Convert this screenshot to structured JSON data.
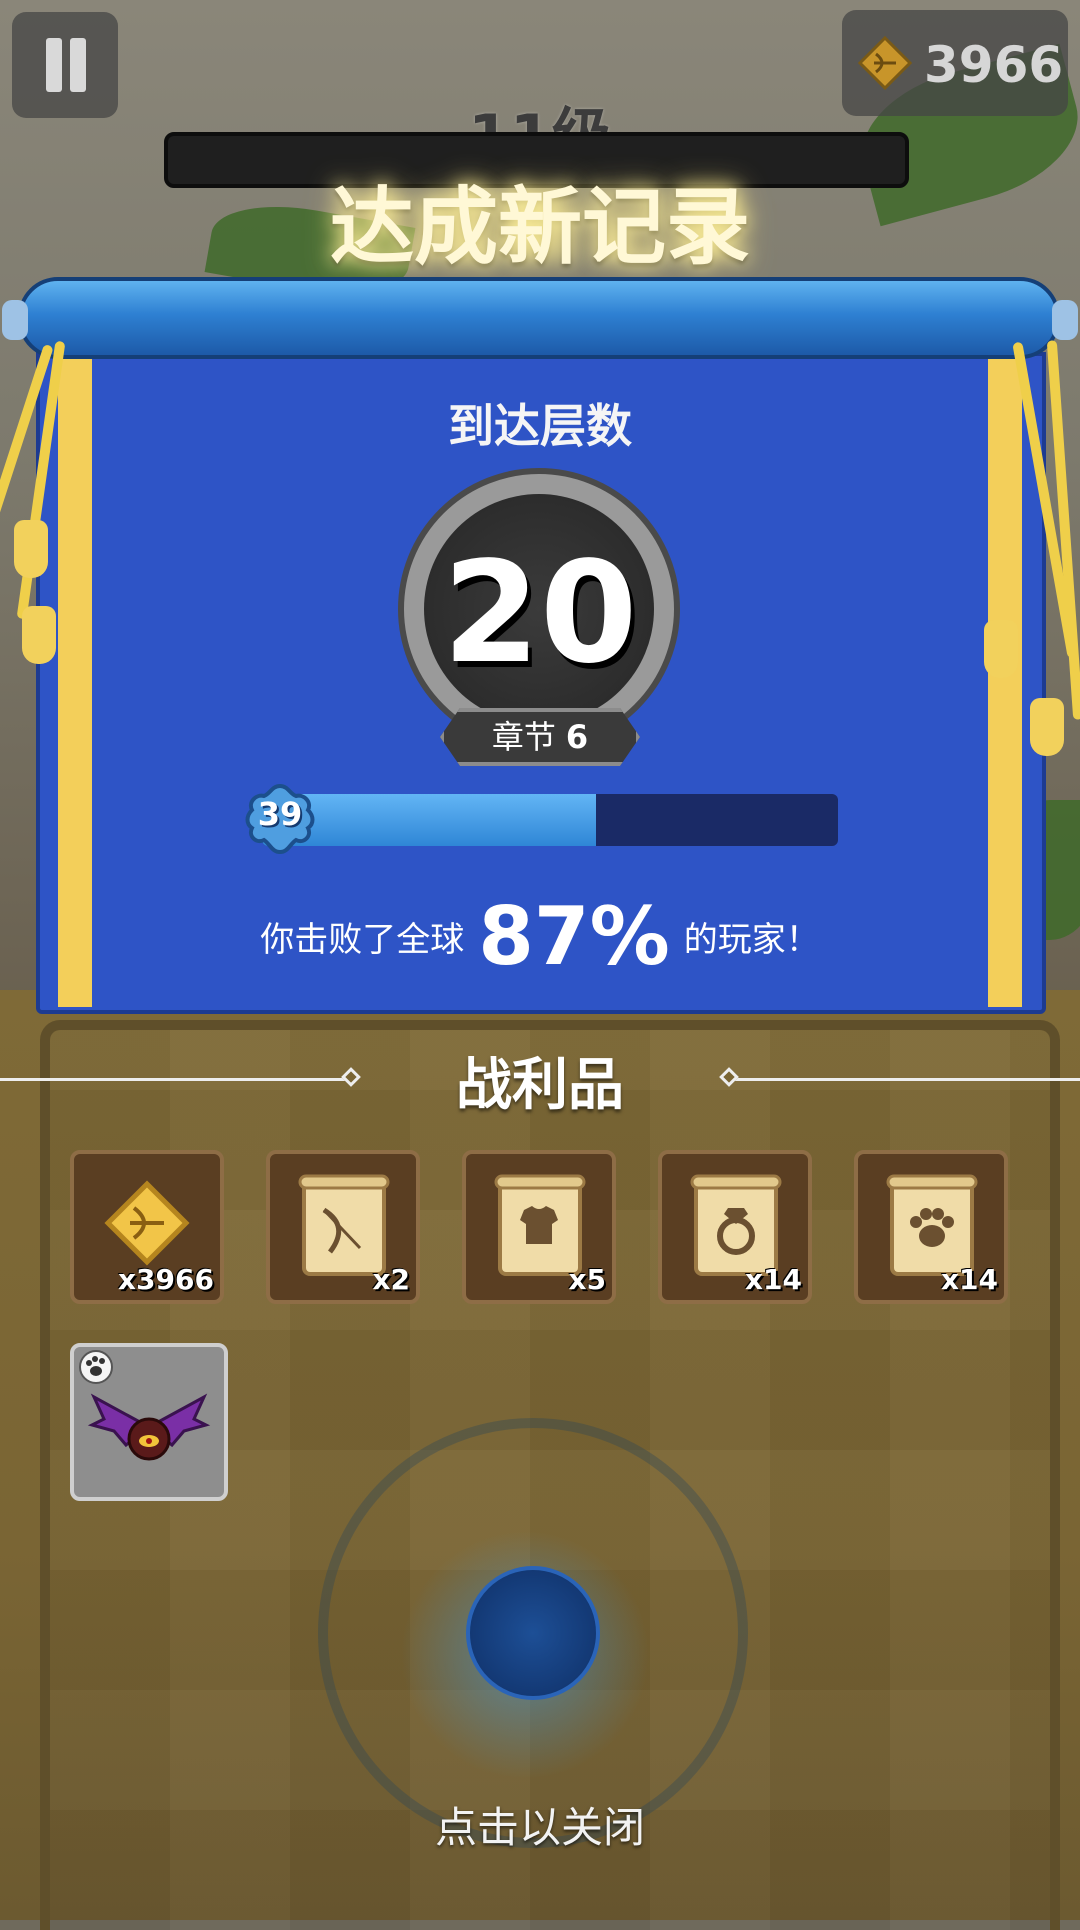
{
  "hud": {
    "gold_value": "3966",
    "level_label": "11级"
  },
  "banner": {
    "title": "达成新记录",
    "reach_label": "到达层数",
    "floor_number": "20",
    "chapter_label": "章节",
    "chapter_number": "6",
    "progress_level": "39",
    "progress_fraction": 0.58,
    "defeat_prefix": "你击败了全球",
    "defeat_percent": "87%",
    "defeat_suffix": "的玩家！"
  },
  "loot": {
    "title": "战利品",
    "items": [
      {
        "icon": "gold-bow-gem-icon",
        "count": "x3966"
      },
      {
        "icon": "bow-scroll-icon",
        "count": "x2"
      },
      {
        "icon": "armor-scroll-icon",
        "count": "x5"
      },
      {
        "icon": "ring-scroll-icon",
        "count": "x14"
      },
      {
        "icon": "paw-scroll-icon",
        "count": "x14"
      }
    ],
    "pet": {
      "icon": "bat-pet-icon"
    }
  },
  "footer": {
    "close_hint": "点击以关闭"
  },
  "colors": {
    "panel_blue": "#2e54c6",
    "progress_fill": "#4aa2e8",
    "stripe_gold": "#f3cf5a",
    "tile_brown": "#5a3e22"
  }
}
